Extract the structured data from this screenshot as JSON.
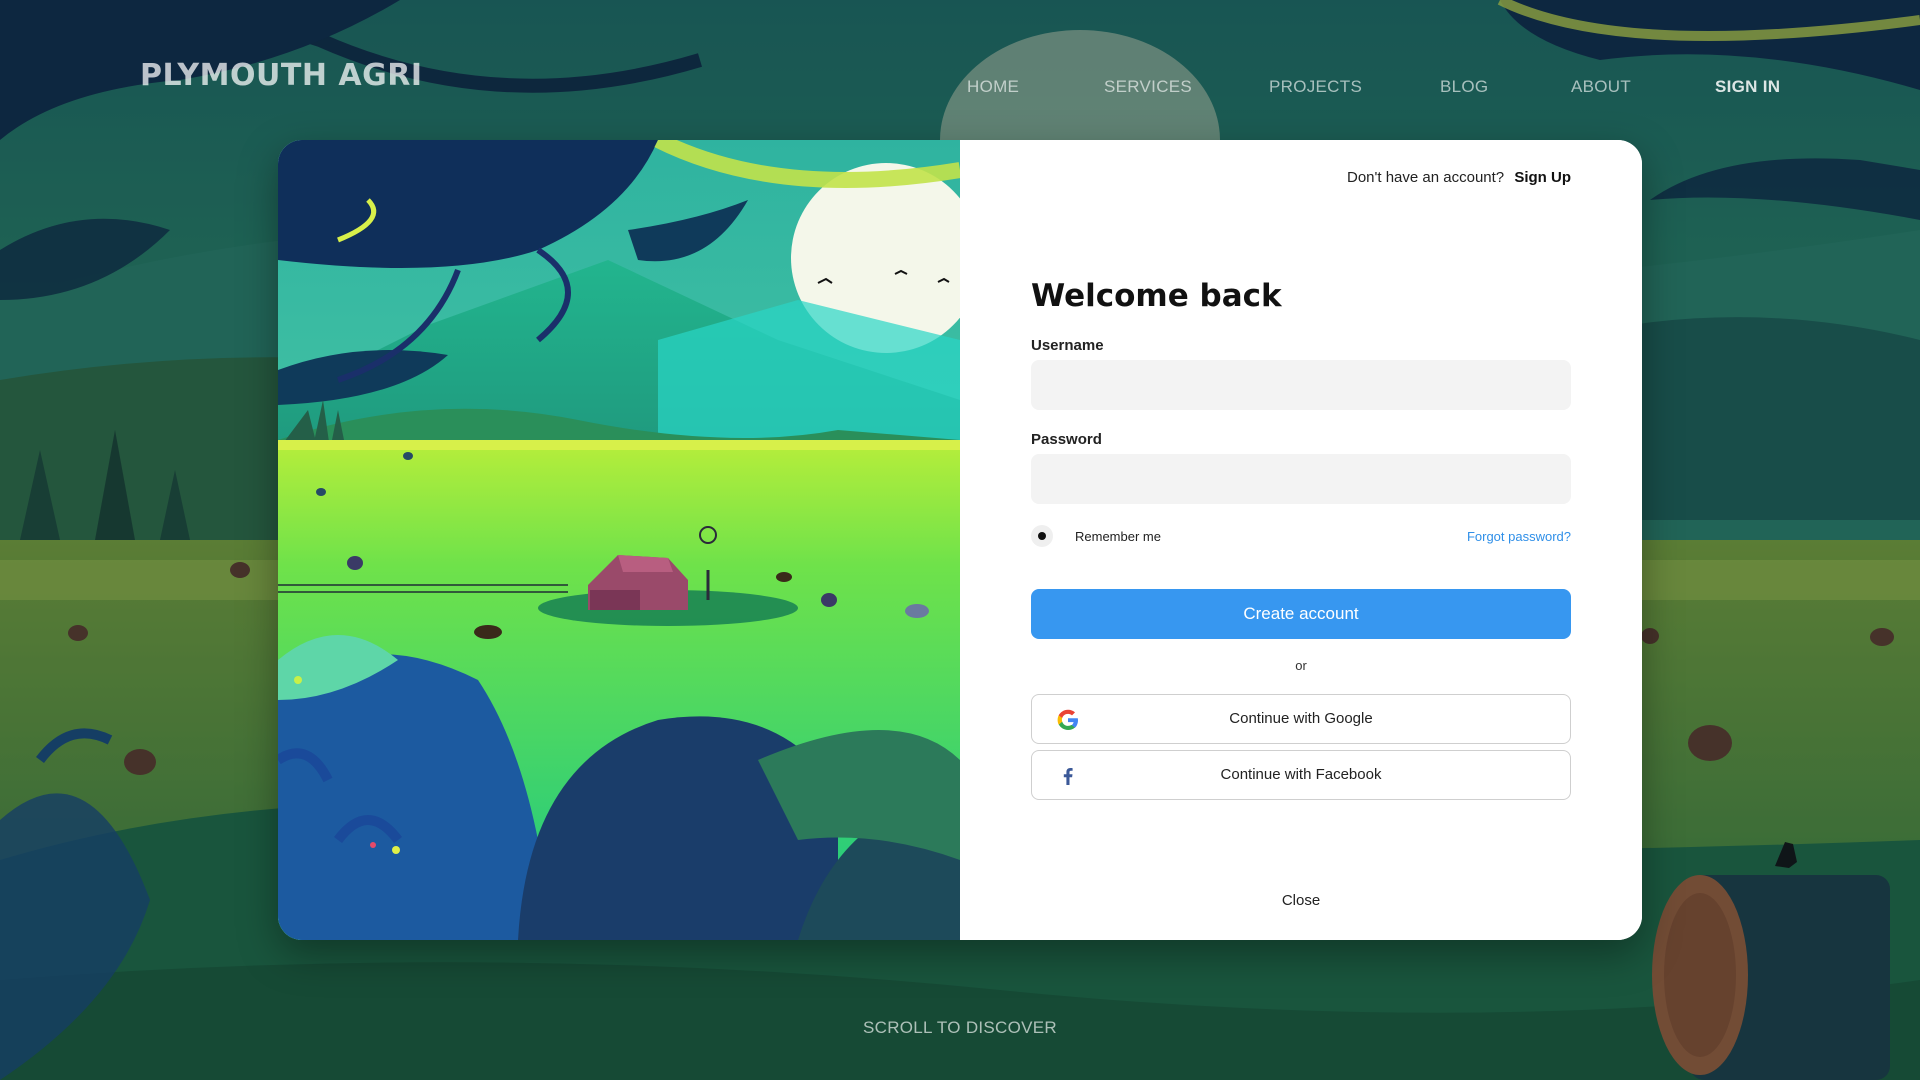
{
  "header": {
    "brand": "PLYMOUTH AGRI",
    "nav": [
      "HOME",
      "SERVICES",
      "PROJECTS",
      "BLOG",
      "ABOUT",
      "SIGN IN"
    ]
  },
  "modal": {
    "signup_prompt": "Don't have an account?",
    "signup_link": "Sign Up",
    "title": "Welcome back",
    "username_label": "Username",
    "username_value": "",
    "password_label": "Password",
    "password_value": "",
    "remember_label": "Remember me",
    "remember_checked": true,
    "forgot_link": "Forgot password?",
    "primary_button": "Create account",
    "divider": "or",
    "google_button": "Continue with Google",
    "facebook_button": "Continue with Facebook",
    "close": "Close"
  },
  "footer": {
    "scroll_hint": "SCROLL TO DISCOVER"
  },
  "icons": {
    "google": "google-icon",
    "facebook": "facebook-icon"
  },
  "colors": {
    "primary": "#3797f0",
    "link": "#2f8fe8",
    "input_bg": "#f3f3f3"
  }
}
